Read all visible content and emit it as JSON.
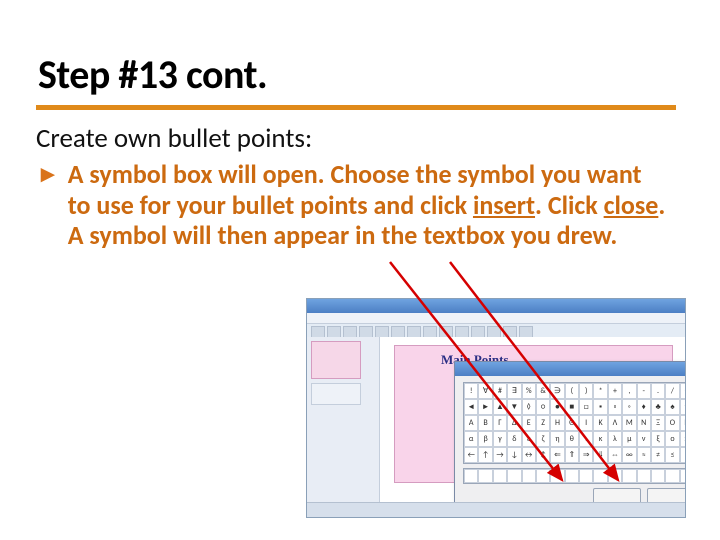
{
  "title": "Step #13 cont.",
  "intro": "Create own bullet points:",
  "bullet_marker": "►",
  "body": {
    "seg1": "A symbol box will open. Choose the symbol you want to use for your bullet points and click ",
    "insert_word": "insert",
    "seg2": ". Click ",
    "close_word": "close",
    "seg3": ". A symbol will then appear in the textbox you drew."
  },
  "screenshot": {
    "slide_heading": "Main Points"
  },
  "colors": {
    "accent_rule": "#e08a1a",
    "body_text": "#cc6a10",
    "arrow": "#d50000"
  }
}
